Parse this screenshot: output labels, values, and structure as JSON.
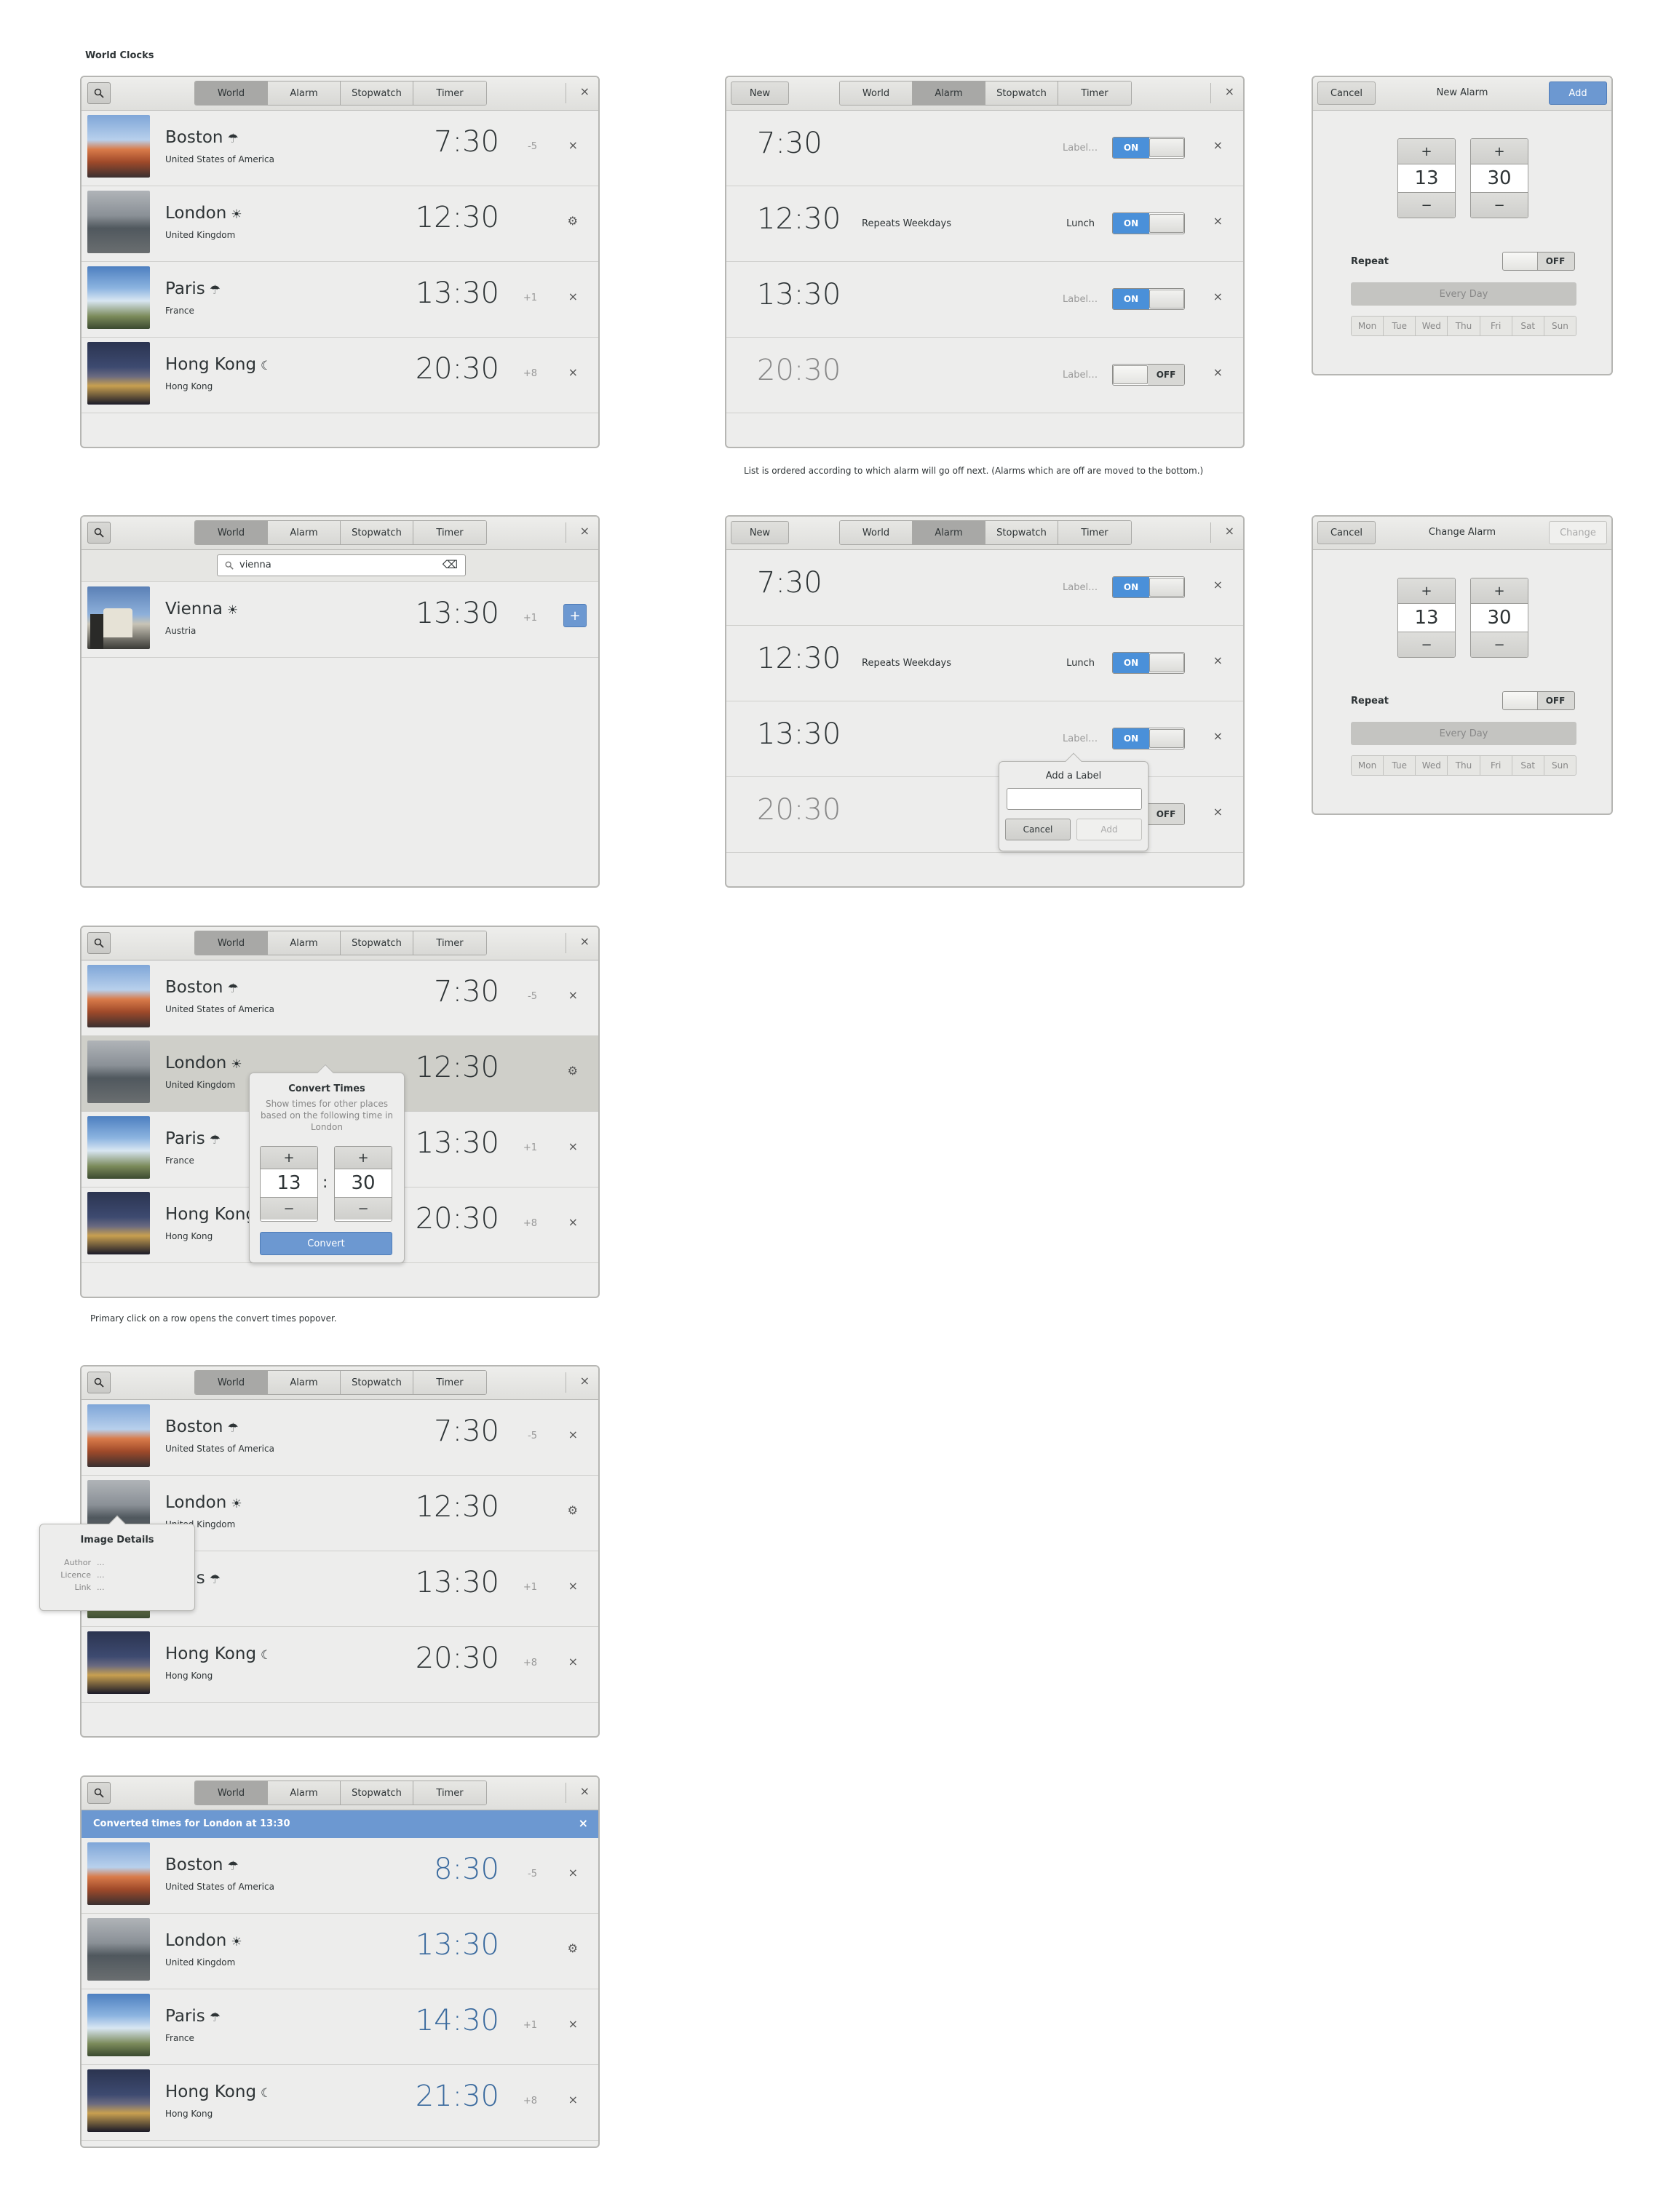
{
  "page_title": "World Clocks",
  "notes": {
    "alarm_order": "List is ordered according to which alarm will go off next. (Alarms which are off are moved to the bottom.)",
    "convert_click": "Primary click on a row opens the convert times popover."
  },
  "tabs": [
    "World",
    "Alarm",
    "Stopwatch",
    "Timer"
  ],
  "close_symbol": "×",
  "new_label": "New",
  "world_clocks": [
    {
      "city": "Boston",
      "country": "United States of America",
      "time": "7:30",
      "offset": "-5",
      "weather": "☂",
      "action": "×"
    },
    {
      "city": "London",
      "country": "United Kingdom",
      "time": "12:30",
      "offset": "",
      "weather": "☀",
      "action": "⚙"
    },
    {
      "city": "Paris",
      "country": "France",
      "time": "13:30",
      "offset": "+1",
      "weather": "☂",
      "action": "×"
    },
    {
      "city": "Hong Kong",
      "country": "Hong Kong",
      "time": "20:30",
      "offset": "+8",
      "weather": "☾",
      "action": "×"
    }
  ],
  "search": {
    "value": "vienna",
    "clear_icon": "⌫"
  },
  "search_result": {
    "city": "Vienna",
    "country": "Austria",
    "time": "13:30",
    "offset": "+1",
    "weather": "☀",
    "add": "+"
  },
  "alarms": [
    {
      "time": "7:30",
      "repeat": "",
      "label": "Label…",
      "state": "ON",
      "on": true
    },
    {
      "time": "12:30",
      "repeat": "Repeats Weekdays",
      "label": "Lunch",
      "state": "ON",
      "on": true
    },
    {
      "time": "13:30",
      "repeat": "",
      "label": "Label…",
      "state": "ON",
      "on": true
    },
    {
      "time": "20:30",
      "repeat": "",
      "label": "Label…",
      "state": "OFF",
      "on": false
    }
  ],
  "new_alarm": {
    "cancel": "Cancel",
    "title": "New Alarm",
    "confirm": "Add",
    "hour": "13",
    "minute": "30",
    "repeat": "Repeat",
    "repeat_state": "OFF",
    "every_day": "Every Day",
    "days": [
      "Mon",
      "Tue",
      "Wed",
      "Thu",
      "Fri",
      "Sat",
      "Sun"
    ]
  },
  "change_alarm": {
    "cancel": "Cancel",
    "title": "Change Alarm",
    "confirm": "Change",
    "hour": "13",
    "minute": "30",
    "repeat": "Repeat",
    "repeat_state": "OFF",
    "every_day": "Every Day",
    "days": [
      "Mon",
      "Tue",
      "Wed",
      "Thu",
      "Fri",
      "Sat",
      "Sun"
    ]
  },
  "label_popover": {
    "title": "Add a Label",
    "value": "",
    "cancel": "Cancel",
    "add": "Add"
  },
  "convert_popover": {
    "title": "Convert Times",
    "desc": "Show times for other places based on the following time in London",
    "hour": "13",
    "minute": "30",
    "button": "Convert",
    "plus": "+",
    "minus": "−",
    "colon": ":"
  },
  "image_details": {
    "title": "Image Details",
    "author": "Author",
    "licence": "Licence",
    "link": "Link",
    "author_val": "...",
    "licence_val": "...",
    "link_val": "..."
  },
  "converted_banner": "Converted times for London at 13:30",
  "converted_clocks": [
    {
      "city": "Boston",
      "country": "United States of America",
      "time": "8:30",
      "offset": "-5",
      "weather": "☂",
      "action": "×"
    },
    {
      "city": "London",
      "country": "United Kingdom",
      "time": "13:30",
      "offset": "",
      "weather": "☀",
      "action": "⚙"
    },
    {
      "city": "Paris",
      "country": "France",
      "time": "14:30",
      "offset": "+1",
      "weather": "☂",
      "action": "×"
    },
    {
      "city": "Hong Kong",
      "country": "Hong Kong",
      "time": "21:30",
      "offset": "+8",
      "weather": "☾",
      "action": "×"
    }
  ],
  "colors": {
    "accent": "#4a90d9",
    "banner": "#6c98d1",
    "converted_time": "#3a6a9e"
  }
}
